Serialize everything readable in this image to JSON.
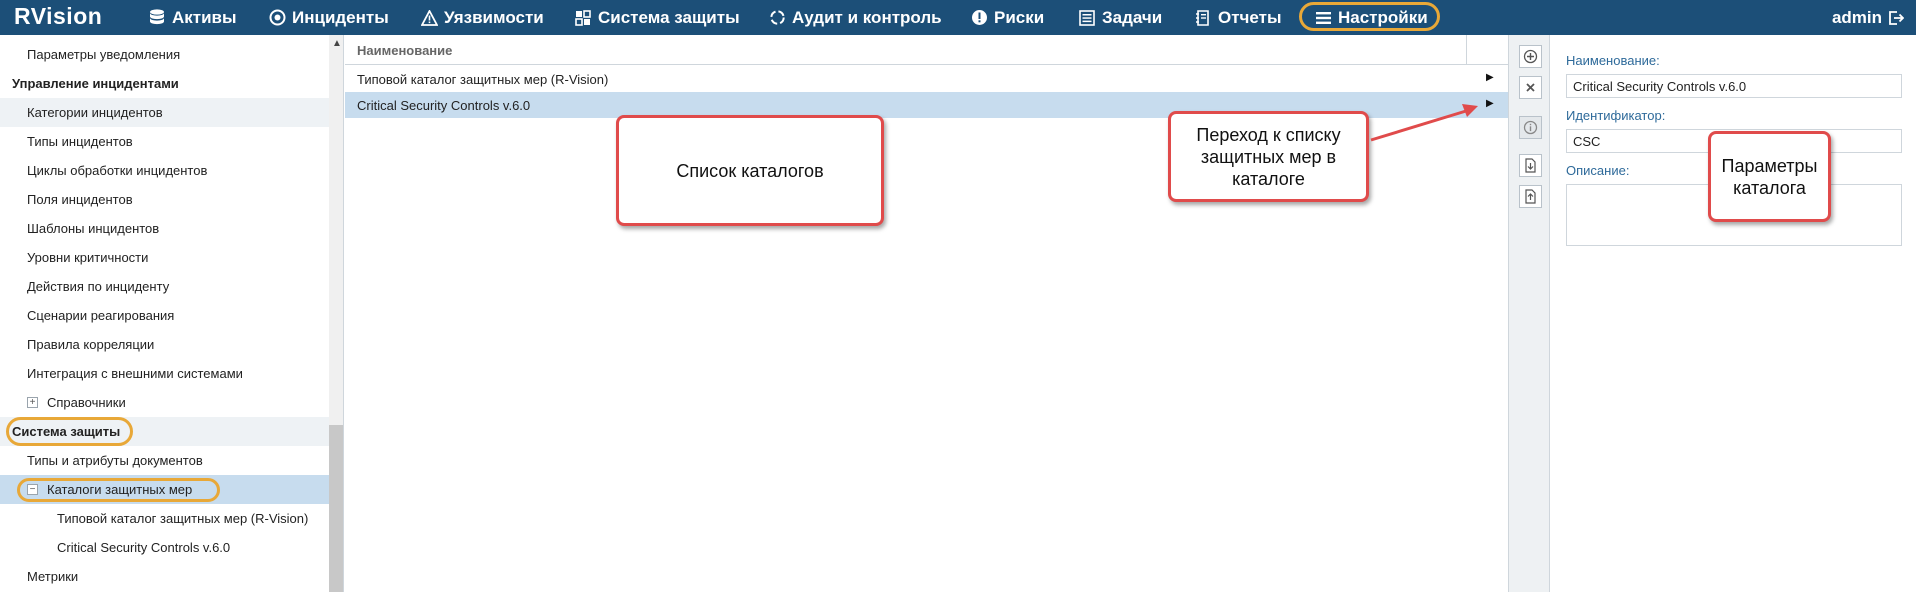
{
  "app": {
    "logo": "RVision",
    "user": "admin"
  },
  "nav": {
    "items": [
      {
        "label": "Активы",
        "icon": "database-icon"
      },
      {
        "label": "Инциденты",
        "icon": "target-icon"
      },
      {
        "label": "Уязвимости",
        "icon": "warning-icon"
      },
      {
        "label": "Система защиты",
        "icon": "grid-icon"
      },
      {
        "label": "Аудит и контроль",
        "icon": "cycle-icon"
      },
      {
        "label": "Риски",
        "icon": "exclamation-icon"
      },
      {
        "label": "Задачи",
        "icon": "tasks-icon"
      },
      {
        "label": "Отчеты",
        "icon": "reports-icon"
      },
      {
        "label": "Настройки",
        "icon": "menu-icon"
      }
    ],
    "active": "Настройки"
  },
  "sidebar": {
    "items": [
      {
        "label": "Параметры уведомления"
      },
      {
        "label": "Управление инцидентами"
      },
      {
        "label": "Категории инцидентов"
      },
      {
        "label": "Типы инцидентов"
      },
      {
        "label": "Циклы обработки инцидентов"
      },
      {
        "label": "Поля инцидентов"
      },
      {
        "label": "Шаблоны инцидентов"
      },
      {
        "label": "Уровни критичности"
      },
      {
        "label": "Действия по инциденту"
      },
      {
        "label": "Сценарии реагирования"
      },
      {
        "label": "Правила корреляции"
      },
      {
        "label": "Интеграция с внешними системами"
      },
      {
        "label": "Справочники",
        "expander": "+"
      },
      {
        "label": "Система защиты"
      },
      {
        "label": "Типы и атрибуты документов"
      },
      {
        "label": "Каталоги защитных мер",
        "expander": "−"
      },
      {
        "label": "Типовой каталог защитных мер (R-Vision)"
      },
      {
        "label": "Critical Security Controls v.6.0"
      },
      {
        "label": "Метрики"
      }
    ]
  },
  "list": {
    "header": "Наименование",
    "rows": [
      {
        "name": "Типовой каталог защитных мер (R-Vision)"
      },
      {
        "name": "Critical Security Controls v.6.0"
      }
    ]
  },
  "props": {
    "name_label": "Наименование:",
    "name_value": "Critical Security Controls v.6.0",
    "id_label": "Идентификатор:",
    "id_value": "CSC",
    "desc_label": "Описание:",
    "desc_value": ""
  },
  "callouts": {
    "catalog_list": "Список каталогов",
    "goto_list": "Переход к списку защитных мер в каталоге",
    "catalog_params": "Параметры каталога"
  },
  "colors": {
    "topbar": "#1c4f78",
    "highlight_ring": "#e8a838",
    "callout_border": "#e04b4b",
    "selection": "#c7dcee"
  }
}
